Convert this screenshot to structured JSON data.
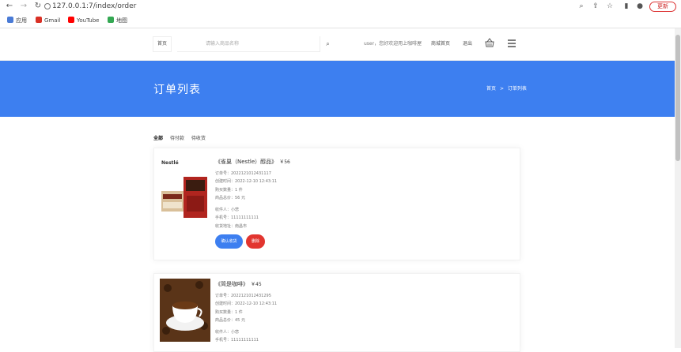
{
  "browser": {
    "url": "127.0.0.1:7/index/order",
    "update_label": "更新",
    "bookmarks": [
      {
        "label": "应用",
        "icon": "apps-grid-icon",
        "color": "#4a7bd6"
      },
      {
        "label": "Gmail",
        "icon": "gmail-icon",
        "color": "#d93025"
      },
      {
        "label": "YouTube",
        "icon": "youtube-icon",
        "color": "#ff0000"
      },
      {
        "label": "地图",
        "icon": "maps-icon",
        "color": "#34a853"
      }
    ]
  },
  "header": {
    "home_label": "首页",
    "search_placeholder": "请输入商品名称",
    "user_text": "user，您好欢迎用上咖啡屋",
    "orders_link": "商城首页",
    "logout_link": "退出"
  },
  "banner": {
    "title": "订单列表",
    "breadcrumb_home": "首页",
    "breadcrumb_sep": ">",
    "breadcrumb_current": "订单列表",
    "color": "#3d7ff0"
  },
  "tabs": [
    "全部",
    "待付款",
    "待收货"
  ],
  "orders": [
    {
      "title": "《雀巢（Nestle）醇品》",
      "price": "￥56",
      "order_no": "订单号：2022121012431117",
      "order_time": "创建时间：2022-12-10 12:43:11",
      "quantity": "购买数量：1 件",
      "total": "商品总价：56 元",
      "receiver": "收件人：小悲",
      "phone": "手机号：11111111111",
      "address": "收货地址：南昌市",
      "brand": "Nestlé",
      "confirm_label": "确认收货",
      "delete_label": "删除"
    },
    {
      "title": "《简是咖啡》",
      "price": "￥45",
      "order_no": "订单号：2022121012431295",
      "order_time": "创建时间：2022-12-10 12:43:11",
      "quantity": "购买数量：1 件",
      "total": "商品总价：45 元",
      "receiver": "收件人：小悲",
      "phone": "手机号：11111111111"
    }
  ],
  "colors": {
    "accent": "#3d7ff0",
    "danger": "#e2352f"
  }
}
